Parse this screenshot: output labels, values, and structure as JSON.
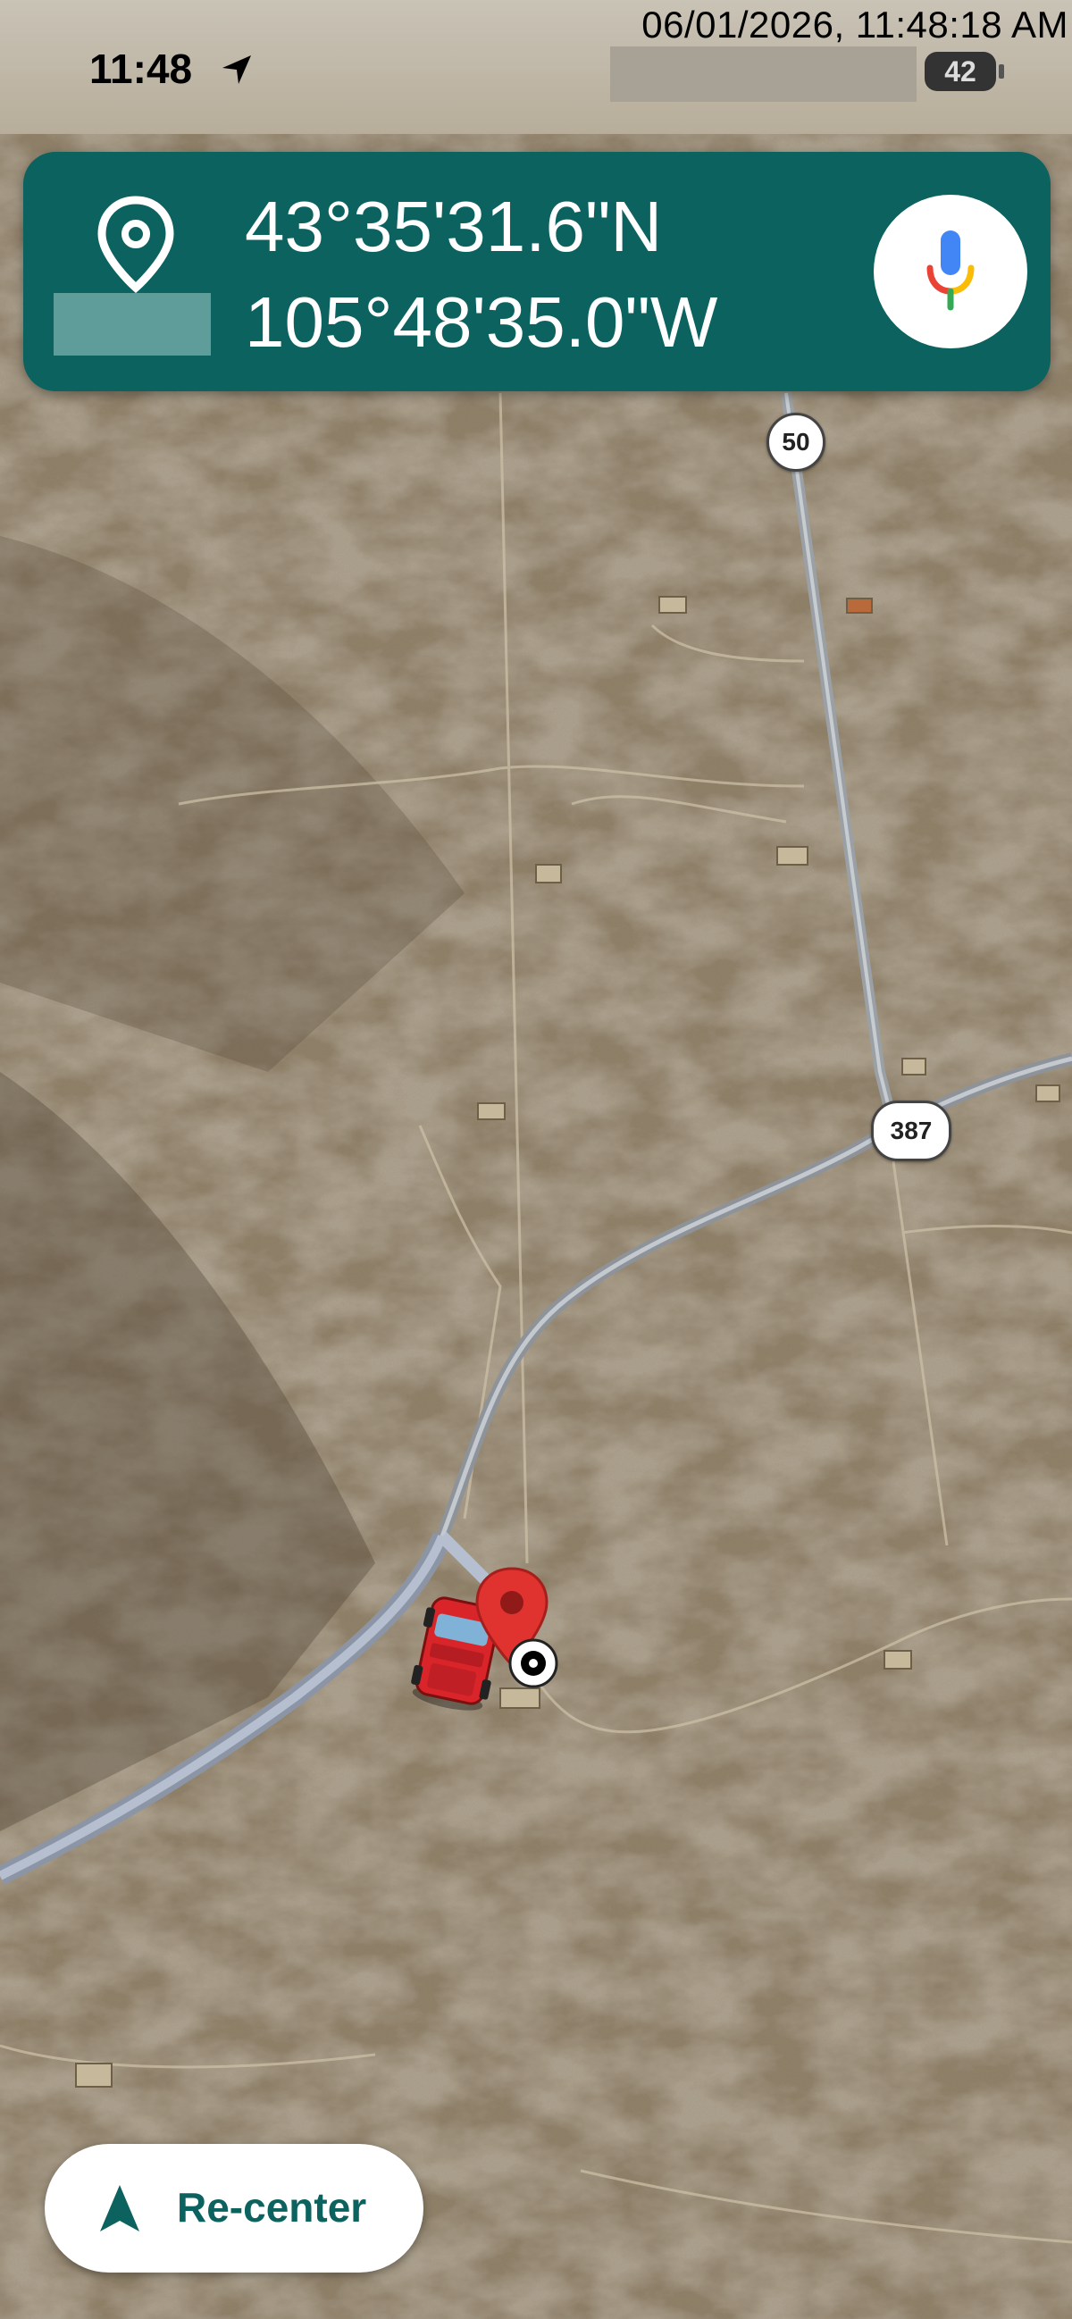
{
  "status_bar": {
    "time": "11:48",
    "timestamp": "06/01/2026, 11:48:18 AM",
    "battery": "42"
  },
  "coordinates": {
    "latitude": "43°35'31.6\"N",
    "longitude": "105°48'35.0\"W"
  },
  "map": {
    "type": "satellite",
    "route_shields": [
      "50",
      "387"
    ]
  },
  "buttons": {
    "recenter_label": "Re-center"
  },
  "icons": {
    "location": "location-arrow-icon",
    "pin": "map-pin-outline-icon",
    "mic": "microphone-icon",
    "vehicle": "red-truck-icon",
    "marker": "red-map-marker-icon",
    "target": "target-dot-icon",
    "navigate": "navigation-arrow-icon"
  },
  "colors": {
    "card": "#0b625e",
    "accent": "#0b625e",
    "marker": "#e0332f"
  }
}
